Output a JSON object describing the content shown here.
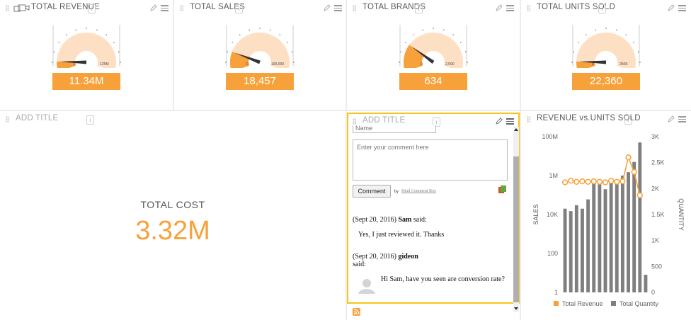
{
  "colors": {
    "accent": "#f7a13a",
    "highlight": "#f5c518",
    "gauge_band": "#fde0c4",
    "bar": "#7f7f7f"
  },
  "kpis": [
    {
      "title": "TOTAL REVENUE",
      "min": "0",
      "max": "125M",
      "value": "11.34M",
      "level": 0.09
    },
    {
      "title": "TOTAL SALES",
      "min": "0",
      "max": "100,000",
      "value": "18,457",
      "level": 0.18
    },
    {
      "title": "TOTAL BRANDS",
      "min": "0",
      "max": "2,500",
      "value": "634",
      "level": 0.25
    },
    {
      "title": "TOTAL UNITS SOLD",
      "min": "0",
      "max": "250K",
      "value": "22,360",
      "level": 0.09
    }
  ],
  "cost_panel": {
    "title": "ADD TITLE",
    "label": "TOTAL COST",
    "value": "3.32M"
  },
  "comment_panel": {
    "title": "ADD TITLE",
    "name_placeholder": "Name",
    "comment_placeholder": "Enter your comment here",
    "comment_button": "Comment",
    "by_text": "by",
    "powered_by": "Html Comment Box",
    "comments": [
      {
        "date": "(Sept 20, 2016)",
        "author": "Sam",
        "said": "said:",
        "text": "Yes, I just reviewed it. Thanks"
      },
      {
        "date": "(Sept 20, 2016)",
        "author": "gideon",
        "said": "said:",
        "text": "Hi Sam, have you seen are conversion rate?"
      }
    ]
  },
  "combo_panel": {
    "title": "REVENUE vs.UNITS SOLD"
  },
  "chart_data": {
    "type": "bar",
    "ylabel": "SALES",
    "y2label": "QUANTITY",
    "yscale": "log",
    "ylim": [
      1,
      100000000
    ],
    "yticks": [
      "100M",
      "1M",
      "10K",
      "100",
      "1"
    ],
    "y2lim": [
      0,
      3000
    ],
    "y2ticks": [
      "3K",
      "2.5K",
      "2K",
      "1.5K",
      "1K",
      "500",
      "0"
    ],
    "series": [
      {
        "name": "Total Revenue",
        "kind": "line",
        "axis": "y2",
        "values": [
          2120,
          2150,
          2130,
          2140,
          2130,
          2140,
          2130,
          2120,
          2150,
          2130,
          2140,
          2600,
          2320,
          1870
        ]
      },
      {
        "name": "Total Quantity",
        "kind": "bar",
        "axis": "y",
        "values": [
          20000,
          15000,
          30000,
          20000,
          60000,
          500000,
          500000,
          200000,
          600000,
          500000,
          1000000,
          1500000,
          5000000,
          50000000,
          8
        ]
      }
    ],
    "legend": "bottom"
  }
}
